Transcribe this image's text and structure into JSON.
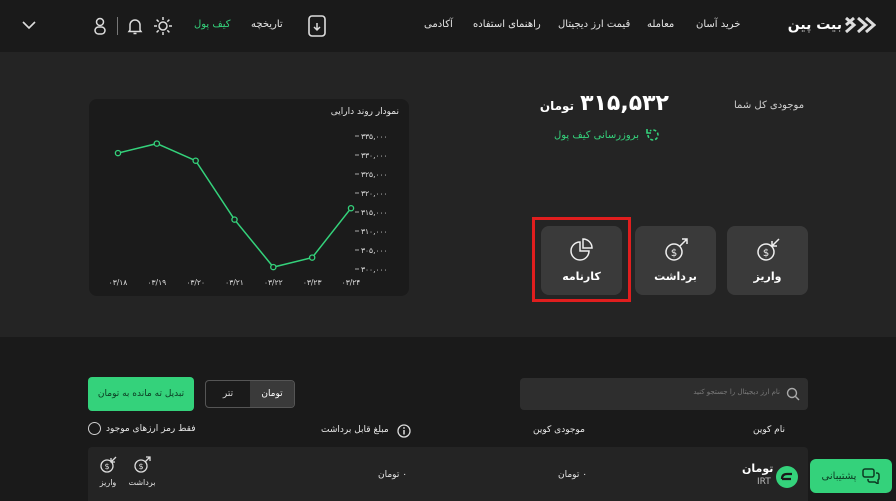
{
  "header": {
    "logo_text": "بیت پین",
    "nav": [
      "خرید آسان",
      "معامله",
      "قیمت ارز دیجیتال",
      "راهنمای استفاده",
      "آکادمی"
    ],
    "wallet_label": "کیف پول",
    "history_label": "تاریخچه"
  },
  "chart_data": {
    "type": "line",
    "title": "نمودار روند دارایی",
    "categories": [
      "۰۳/۱۸",
      "۰۳/۱۹",
      "۰۳/۲۰",
      "۰۳/۲۱",
      "۰۳/۲۲",
      "۰۳/۲۳",
      "۰۳/۲۴"
    ],
    "values": [
      330500,
      333000,
      328500,
      313000,
      300500,
      303000,
      316000
    ],
    "y_ticks": [
      300000,
      305000,
      310000,
      315000,
      320000,
      325000,
      330000,
      335000
    ],
    "y_tick_labels": [
      "۳۰۰,۰۰۰",
      "۳۰۵,۰۰۰",
      "۳۱۰,۰۰۰",
      "۳۱۵,۰۰۰",
      "۳۲۰,۰۰۰",
      "۳۲۵,۰۰۰",
      "۳۳۰,۰۰۰",
      "۳۳۵,۰۰۰"
    ],
    "ylim": [
      300000,
      335000
    ],
    "line_color": "#34d27b",
    "grid": false
  },
  "balance": {
    "label": "موجودی کل شما",
    "value": "۳۱۵,۵۳۲",
    "unit": "تومان",
    "refresh_label": "بروزرسانی کیف پول"
  },
  "actions": [
    {
      "label": "واریز",
      "icon": "deposit-icon"
    },
    {
      "label": "برداشت",
      "icon": "withdraw-icon"
    },
    {
      "label": "کارنامه",
      "icon": "pie-chart-icon"
    }
  ],
  "search": {
    "placeholder": "نام ارز دیجیتال را جستجو کنید"
  },
  "currency_toggle": {
    "options": [
      "تومان",
      "تتر"
    ],
    "selected": "تومان"
  },
  "convert_button": "تبدیل ته مانده به تومان",
  "table": {
    "headers": {
      "coin_name": "نام کوین",
      "coin_balance": "موجودی کوین",
      "withdrawable": "مبلغ قابل برداشت"
    },
    "filter_label": "فقط رمز ارزهای موجود",
    "rows": [
      {
        "name": "تومان",
        "symbol": "IRT",
        "balance": "۰ تومان",
        "withdrawable": "۰ تومان",
        "deposit": "واریز",
        "withdraw": "برداشت"
      }
    ]
  },
  "support_button": "پشتیبانی",
  "colors": {
    "accent": "#34d27b",
    "highlight": "#e01e1e"
  }
}
